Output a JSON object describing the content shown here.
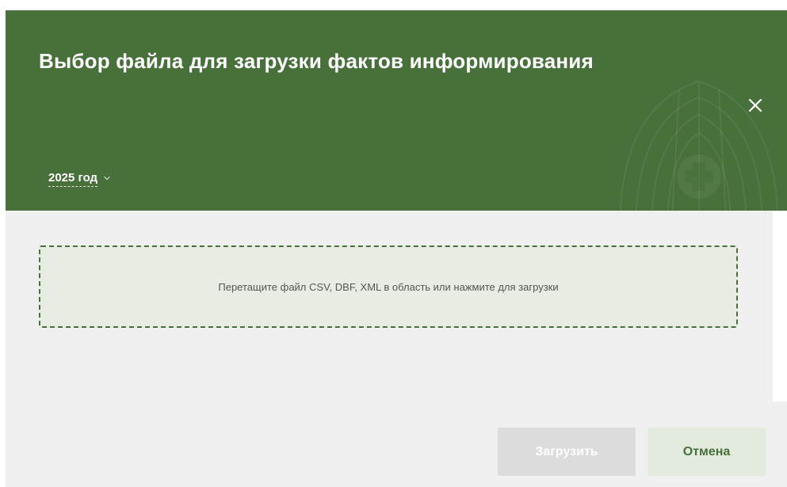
{
  "dialog": {
    "title": "Выбор файла для загрузки фактов информирования",
    "close_icon": "close-icon",
    "year_select": {
      "selected": "2025 год",
      "icon": "chevron-down-icon"
    },
    "emblem_icon": "emblem-watermark-icon"
  },
  "dropzone": {
    "text": "Перетащите файл CSV, DBF, XML в область или нажмите для загрузки"
  },
  "footer": {
    "upload_label": "Загрузить",
    "cancel_label": "Отмена"
  },
  "colors": {
    "header_bg": "#47703a",
    "body_bg": "#f0f0f0",
    "dropzone_border": "#47703a",
    "upload_disabled_bg": "#dcdcdc",
    "cancel_bg": "#e3ebdf"
  }
}
